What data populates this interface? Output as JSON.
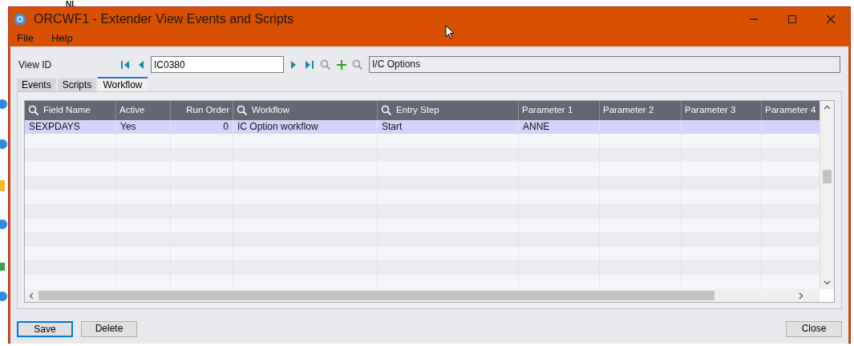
{
  "background": {
    "text": "NL"
  },
  "window": {
    "title": "ORCWF1 - Extender View Events and Scripts"
  },
  "menu": [
    {
      "label": "File"
    },
    {
      "label": "Help"
    }
  ],
  "view_id": {
    "label": "View ID",
    "value": "IC0380",
    "description": "I/C Options"
  },
  "tabs": [
    {
      "label": "Events",
      "selected": false
    },
    {
      "label": "Scripts",
      "selected": false
    },
    {
      "label": "Workflow",
      "selected": true
    }
  ],
  "table": {
    "columns": [
      {
        "label": "Field Name",
        "searchable": true,
        "kind": "text"
      },
      {
        "label": "Active",
        "searchable": false,
        "kind": "text"
      },
      {
        "label": "Run Order",
        "searchable": false,
        "kind": "number"
      },
      {
        "label": "Workflow",
        "searchable": true,
        "kind": "text"
      },
      {
        "label": "Entry Step",
        "searchable": true,
        "kind": "text"
      },
      {
        "label": "Parameter 1",
        "searchable": false,
        "kind": "text"
      },
      {
        "label": "Parameter 2",
        "searchable": false,
        "kind": "text"
      },
      {
        "label": "Parameter 3",
        "searchable": false,
        "kind": "text"
      },
      {
        "label": "Parameter 4",
        "searchable": false,
        "kind": "text"
      }
    ],
    "rows": [
      {
        "selected": true,
        "cells": [
          "SEXPDAYS",
          "Yes",
          "0",
          "IC Option workflow",
          "Start",
          "ANNE",
          "",
          "",
          ""
        ]
      }
    ]
  },
  "buttons": [
    {
      "label": "Save",
      "kind": "default"
    },
    {
      "label": "Delete",
      "kind": "normal"
    },
    {
      "label": "Close",
      "kind": "normal"
    }
  ]
}
